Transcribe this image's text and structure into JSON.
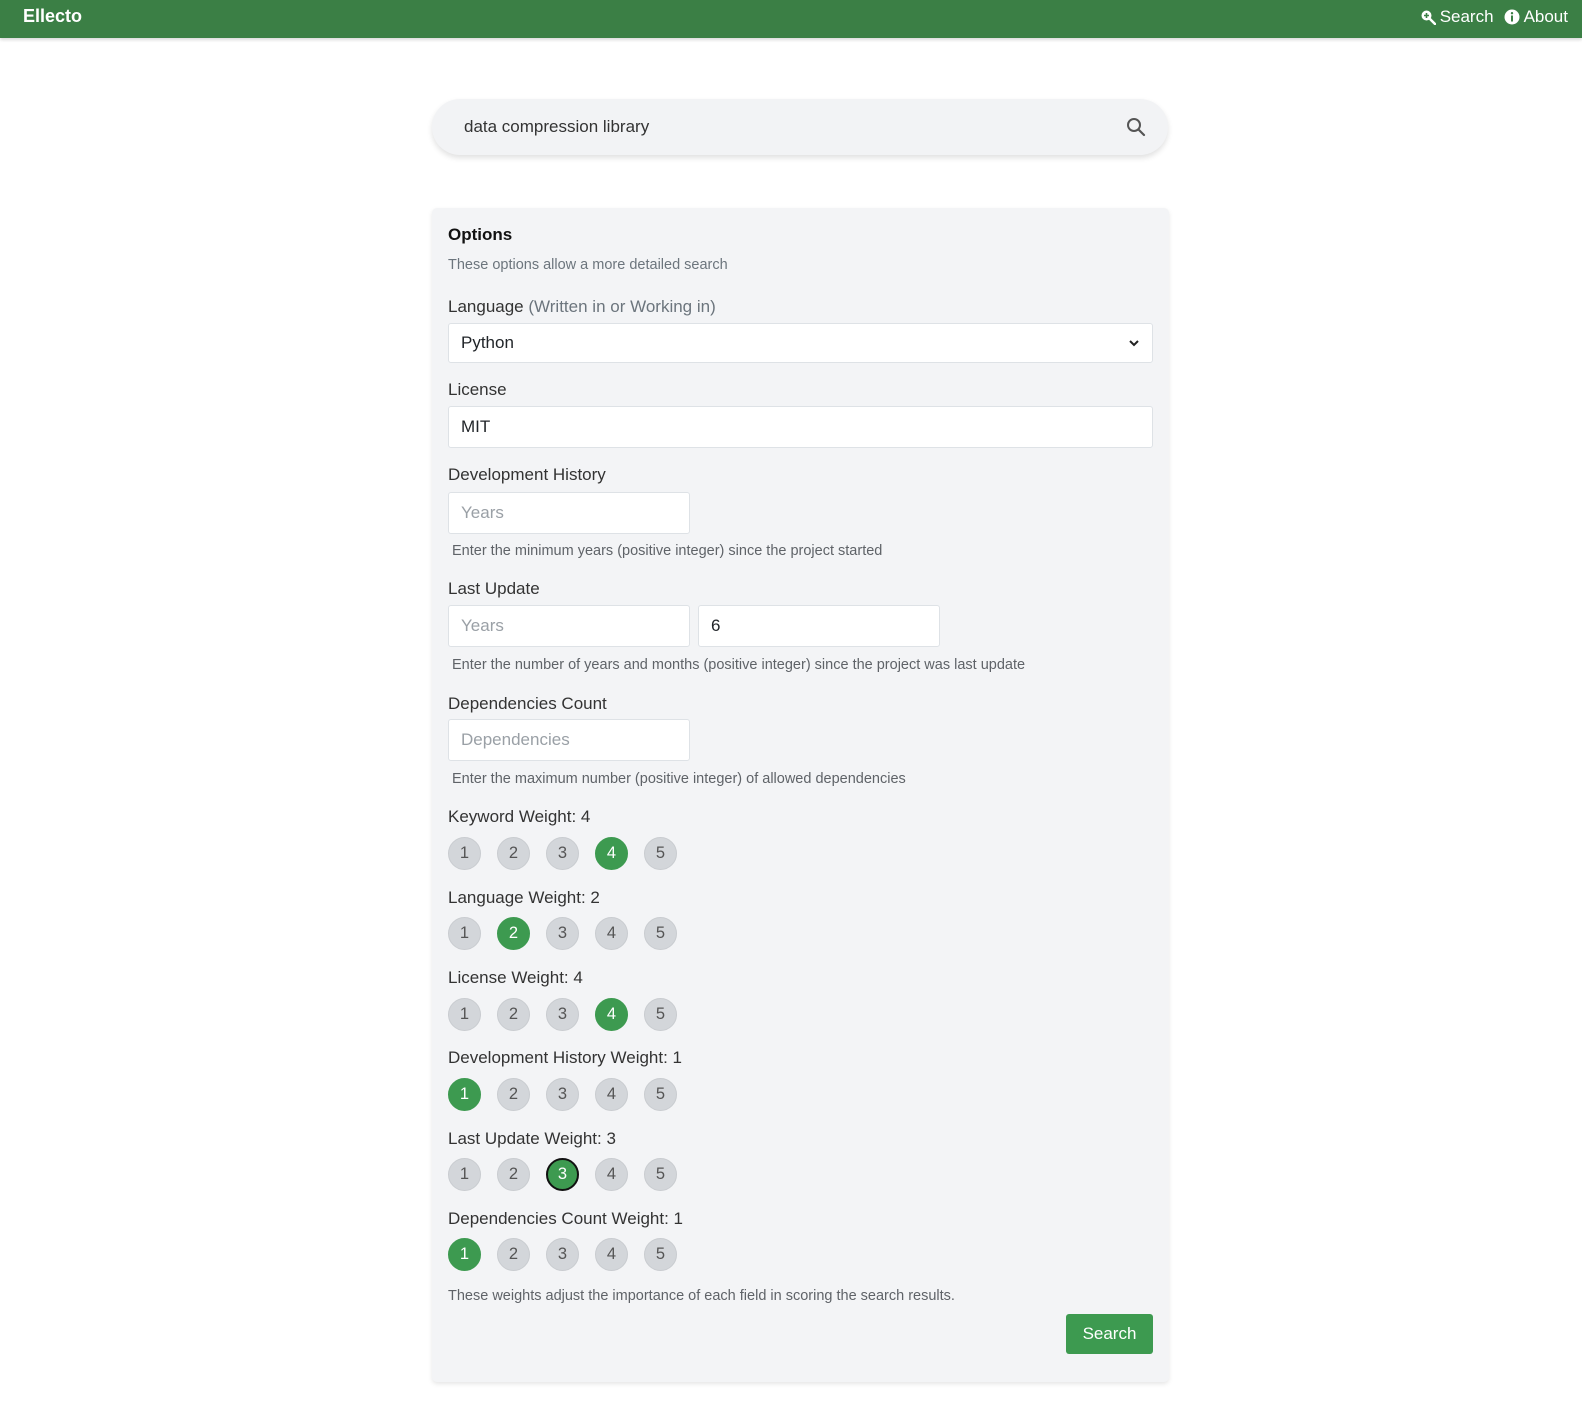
{
  "navbar": {
    "brand": "Ellecto",
    "search_label": "Search",
    "about_label": "About"
  },
  "search": {
    "value": "data compression library"
  },
  "options": {
    "title": "Options",
    "subtitle": "These options allow a more detailed search",
    "language": {
      "label": "Language",
      "label_hint": "(Written in or Working in)",
      "selected": "Python"
    },
    "license": {
      "label": "License",
      "value": "MIT"
    },
    "development_history": {
      "label": "Development History",
      "placeholder": "Years",
      "help": "Enter the minimum years (positive integer) since the project started"
    },
    "last_update": {
      "label": "Last Update",
      "years_placeholder": "Years",
      "months_value": "6",
      "help": "Enter the number of years and months (positive integer) since the project was last update"
    },
    "dependencies_count": {
      "label": "Dependencies Count",
      "placeholder": "Dependencies",
      "help": "Enter the maximum number (positive integer) of allowed dependencies"
    },
    "weight_options": [
      "1",
      "2",
      "3",
      "4",
      "5"
    ],
    "weights": [
      {
        "label": "Keyword Weight: 4",
        "value": 4
      },
      {
        "label": "Language Weight: 2",
        "value": 2
      },
      {
        "label": "License Weight: 4",
        "value": 4
      },
      {
        "label": "Development History Weight: 1",
        "value": 1
      },
      {
        "label": "Last Update Weight: 3",
        "value": 3,
        "focused": true
      },
      {
        "label": "Dependencies Count Weight: 1",
        "value": 1
      }
    ],
    "weights_note": "These weights adjust the importance of each field in scoring the search results.",
    "search_button": "Search"
  },
  "colors": {
    "navbar": "#3b7f45",
    "accent": "#3d9a50",
    "panel": "#f3f4f6"
  }
}
